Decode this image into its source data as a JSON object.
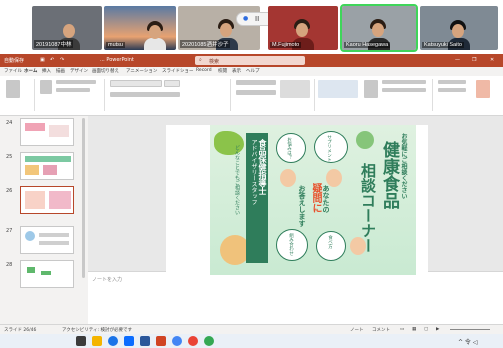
{
  "video_call": {
    "participants": [
      {
        "name": "20191087中林",
        "active": false
      },
      {
        "name": "mutsu",
        "active": false
      },
      {
        "name": "20201085酒井沙子",
        "active": false
      },
      {
        "name": "M.Fujimoto",
        "active": false
      },
      {
        "name": "Kaoru Hasegawa",
        "active": true
      },
      {
        "name": "Katsuyuki Saito",
        "active": false
      }
    ],
    "controls_pill": {
      "pause_icon": "II",
      "stop_icon": "■"
    }
  },
  "powerpoint": {
    "title_bar": {
      "autosave": "自動保存",
      "filename": "... PowerPoint",
      "search_placeholder": "検索"
    },
    "menu_tabs": [
      "ファイル",
      "ホーム",
      "挿入",
      "描画",
      "デザイン",
      "画面切り替え",
      "アニメーション",
      "スライドショー",
      "Record",
      "校閲",
      "表示",
      "ヘルプ"
    ],
    "slide_numbers": [
      "24",
      "25",
      "26",
      "27",
      "28"
    ],
    "notes_placeholder": "ノートを入力",
    "status": {
      "slide_info": "スライド 26/46",
      "accessibility": "アクセシビリティ: 検討が必要です",
      "notes": "ノート",
      "comments": "コメント"
    },
    "current_slide": {
      "heading": "健康食品",
      "heading2": "相談コーナー",
      "top_line": "お気軽にご相談ください",
      "center_line1": "あなたの",
      "center_line2": "疑問に",
      "center_line3": "お答えします",
      "left_label": "アドバイザリースタッフ",
      "left_title": "食品保健指導士",
      "left_sub": "どんなことでもご相談ください",
      "bubble1": "お悩みは？",
      "bubble2": "サプリメント",
      "bubble3": "組み合わせ",
      "bubble4": "食べ方",
      "bubble5": "体に合う"
    }
  },
  "taskbar": {
    "system_tray": "^ 令 ◁"
  },
  "colors": {
    "pp_accent": "#b7472a",
    "slide_green": "#2f7d5b",
    "active_tile": "#3fd55a"
  }
}
